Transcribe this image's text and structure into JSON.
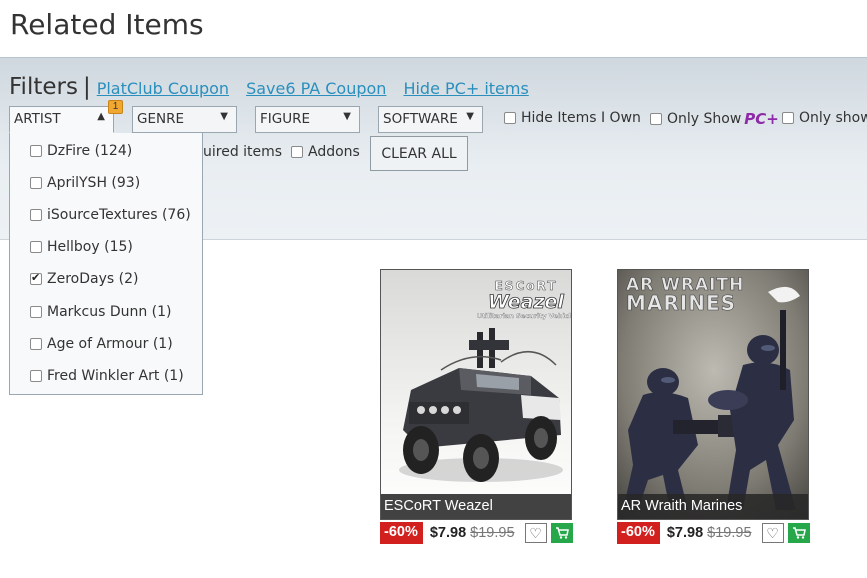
{
  "page": {
    "title": "Related Items"
  },
  "filters": {
    "label": "Filters",
    "separator": "|",
    "links": [
      "PlatClub Coupon",
      "Save6 PA Coupon",
      "Hide PC+ items"
    ],
    "dropdowns": [
      {
        "label": "ARTIST",
        "open": true,
        "badge": "1"
      },
      {
        "label": "GENRE",
        "open": false
      },
      {
        "label": "FIGURE",
        "open": false
      },
      {
        "label": "SOFTWARE",
        "open": false
      }
    ],
    "checkboxes": {
      "hide_owned": "Hide Items I Own",
      "only_show": "Only Show",
      "only_show_pcplus": "PC+",
      "only_show_2": "Only show",
      "acquired": "uired items",
      "addons": "Addons"
    },
    "clear_all": "CLEAR ALL"
  },
  "artist_options": [
    {
      "label": "DzFire (124)",
      "checked": false
    },
    {
      "label": "AprilYSH (93)",
      "checked": false
    },
    {
      "label": "iSourceTextures (76)",
      "checked": false
    },
    {
      "label": "Hellboy (15)",
      "checked": false
    },
    {
      "label": "ZeroDays (2)",
      "checked": true
    },
    {
      "label": "Markcus Dunn (1)",
      "checked": false
    },
    {
      "label": "Age of Armour (1)",
      "checked": false
    },
    {
      "label": "Fred Winkler Art (1)",
      "checked": false
    }
  ],
  "products": [
    {
      "name": "ESCoRT Weazel",
      "image_caption_1": "ESCoRT",
      "image_caption_2": "Weazel",
      "image_caption_3": "Utilitarian Security Vehicle",
      "discount": "-60%",
      "price": "$7.98",
      "old_price": "$19.95"
    },
    {
      "name": "AR Wraith Marines",
      "image_caption_1": "AR WRAITH",
      "image_caption_2": "MARINES",
      "discount": "-60%",
      "price": "$7.98",
      "old_price": "$19.95"
    }
  ],
  "icons": {
    "wishlist": "heart-icon",
    "cart": "cart-icon",
    "cart_color": "#26a84a",
    "discount_color": "#d2201f",
    "link_color": "#2a8fbd",
    "badge_color": "#f0a830"
  }
}
